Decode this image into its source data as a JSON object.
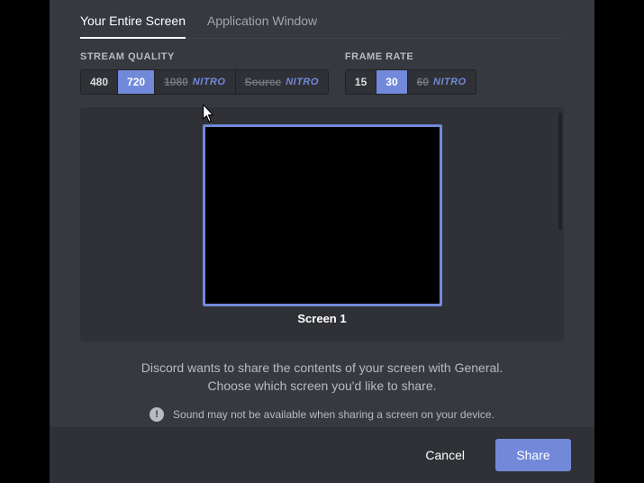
{
  "tabs": {
    "entire_screen": "Your Entire Screen",
    "app_window": "Application Window"
  },
  "quality": {
    "title": "STREAM QUALITY",
    "opt_480": "480",
    "opt_720": "720",
    "opt_1080": "1080",
    "opt_source": "Source",
    "nitro_badge": "NITRO"
  },
  "framerate": {
    "title": "FRAME RATE",
    "opt_15": "15",
    "opt_30": "30",
    "opt_60": "60",
    "nitro_badge": "NITRO"
  },
  "preview": {
    "screen1_label": "Screen 1"
  },
  "info": {
    "line1": "Discord wants to share the contents of your screen with General.",
    "line2": "Choose which screen you'd like to share.",
    "warning": "Sound may not be available when sharing a screen on your device."
  },
  "footer": {
    "cancel": "Cancel",
    "share": "Share"
  },
  "colors": {
    "accent": "#7289da",
    "bg_modal": "#36393f",
    "bg_panel": "#2f3136"
  }
}
